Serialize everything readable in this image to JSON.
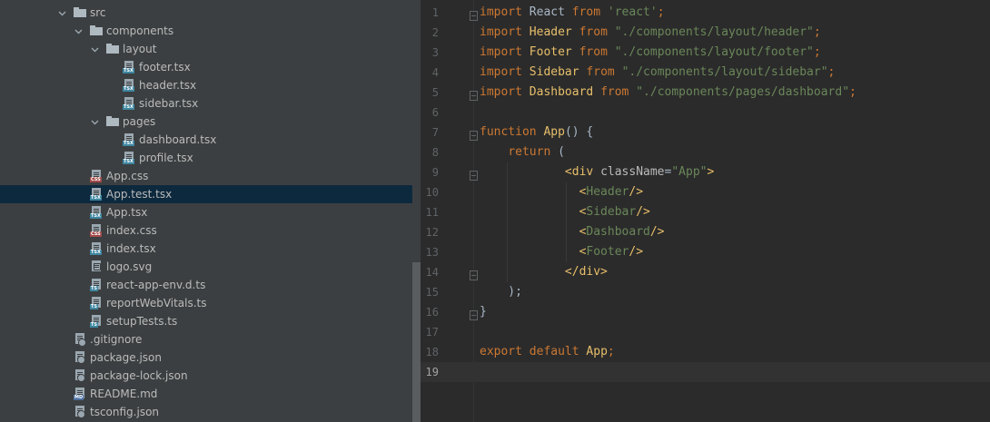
{
  "project_tree": {
    "items": [
      {
        "label": "src",
        "kind": "folder",
        "expanded": true,
        "depth": 0
      },
      {
        "label": "components",
        "kind": "folder",
        "expanded": true,
        "depth": 1
      },
      {
        "label": "layout",
        "kind": "folder",
        "expanded": true,
        "depth": 2
      },
      {
        "label": "footer.tsx",
        "kind": "tsx",
        "depth": 3
      },
      {
        "label": "header.tsx",
        "kind": "tsx",
        "depth": 3
      },
      {
        "label": "sidebar.tsx",
        "kind": "tsx",
        "depth": 3
      },
      {
        "label": "pages",
        "kind": "folder",
        "expanded": true,
        "depth": 2
      },
      {
        "label": "dashboard.tsx",
        "kind": "tsx",
        "depth": 3
      },
      {
        "label": "profile.tsx",
        "kind": "tsx",
        "depth": 3
      },
      {
        "label": "App.css",
        "kind": "css",
        "depth": 1
      },
      {
        "label": "App.test.tsx",
        "kind": "tsx",
        "depth": 1,
        "selected": true
      },
      {
        "label": "App.tsx",
        "kind": "tsx",
        "depth": 1
      },
      {
        "label": "index.css",
        "kind": "css",
        "depth": 1
      },
      {
        "label": "index.tsx",
        "kind": "tsx",
        "depth": 1
      },
      {
        "label": "logo.svg",
        "kind": "svg",
        "depth": 1
      },
      {
        "label": "react-app-env.d.ts",
        "kind": "ts",
        "depth": 1
      },
      {
        "label": "reportWebVitals.ts",
        "kind": "ts",
        "depth": 1
      },
      {
        "label": "setupTests.ts",
        "kind": "ts",
        "depth": 1
      },
      {
        "label": ".gitignore",
        "kind": "gitignore",
        "depth": 0
      },
      {
        "label": "package.json",
        "kind": "json",
        "depth": 0
      },
      {
        "label": "package-lock.json",
        "kind": "json",
        "depth": 0
      },
      {
        "label": "README.md",
        "kind": "md",
        "depth": 0
      },
      {
        "label": "tsconfig.json",
        "kind": "json",
        "depth": 0
      }
    ]
  },
  "icons": {
    "folder": "folder-icon",
    "tsx": "tsx-file-icon",
    "ts": "ts-file-icon",
    "css": "css-file-icon",
    "svg": "svg-file-icon",
    "gitignore": "gitignore-file-icon",
    "json": "json-file-icon",
    "md": "markdown-file-icon",
    "chevron": "chevron-down-icon"
  },
  "file_tag_text": {
    "tsx": "TSX",
    "ts": "TS",
    "css": "CSS",
    "md": "MD"
  },
  "editor": {
    "current_line": 19,
    "lines": [
      {
        "n": "1",
        "tokens": [
          [
            "kw",
            "import"
          ],
          [
            "plain",
            " React "
          ],
          [
            "kw",
            "from"
          ],
          [
            "plain",
            " "
          ],
          [
            "str",
            "'react'"
          ],
          [
            "kw",
            ";"
          ]
        ],
        "fold": true
      },
      {
        "n": "2",
        "tokens": [
          [
            "kw",
            "import"
          ],
          [
            "plain",
            " "
          ],
          [
            "ident",
            "Header"
          ],
          [
            "plain",
            " "
          ],
          [
            "kw",
            "from"
          ],
          [
            "plain",
            " "
          ],
          [
            "str",
            "\"./components/layout/header\""
          ],
          [
            "kw",
            ";"
          ]
        ]
      },
      {
        "n": "3",
        "tokens": [
          [
            "kw",
            "import"
          ],
          [
            "plain",
            " "
          ],
          [
            "ident",
            "Footer"
          ],
          [
            "plain",
            " "
          ],
          [
            "kw",
            "from"
          ],
          [
            "plain",
            " "
          ],
          [
            "str",
            "\"./components/layout/footer\""
          ],
          [
            "kw",
            ";"
          ]
        ]
      },
      {
        "n": "4",
        "tokens": [
          [
            "kw",
            "import"
          ],
          [
            "plain",
            " "
          ],
          [
            "ident",
            "Sidebar"
          ],
          [
            "plain",
            " "
          ],
          [
            "kw",
            "from"
          ],
          [
            "plain",
            " "
          ],
          [
            "str",
            "\"./components/layout/sidebar\""
          ],
          [
            "kw",
            ";"
          ]
        ]
      },
      {
        "n": "5",
        "tokens": [
          [
            "kw",
            "import"
          ],
          [
            "plain",
            " "
          ],
          [
            "ident",
            "Dashboard"
          ],
          [
            "plain",
            " "
          ],
          [
            "kw",
            "from"
          ],
          [
            "plain",
            " "
          ],
          [
            "str",
            "\"./components/pages/dashboard\""
          ],
          [
            "kw",
            ";"
          ]
        ],
        "fold": true
      },
      {
        "n": "6",
        "tokens": []
      },
      {
        "n": "7",
        "tokens": [
          [
            "kw",
            "function"
          ],
          [
            "plain",
            " "
          ],
          [
            "ident",
            "App"
          ],
          [
            "plain",
            "() {"
          ]
        ],
        "fold": true
      },
      {
        "n": "8",
        "tokens": [
          [
            "plain",
            "    "
          ],
          [
            "kw",
            "return"
          ],
          [
            "plain",
            " ("
          ]
        ]
      },
      {
        "n": "9",
        "tokens": [
          [
            "plain",
            "            "
          ],
          [
            "tag-name",
            "<div"
          ],
          [
            "plain",
            " "
          ],
          [
            "attr",
            "className"
          ],
          [
            "plain",
            "="
          ],
          [
            "str",
            "\"App\""
          ],
          [
            "tag-name",
            ">"
          ]
        ],
        "fold": true
      },
      {
        "n": "10",
        "tokens": [
          [
            "plain",
            "              "
          ],
          [
            "tag-name",
            "<"
          ],
          [
            "str",
            "Header"
          ],
          [
            "tag-name",
            "/>"
          ]
        ]
      },
      {
        "n": "11",
        "tokens": [
          [
            "plain",
            "              "
          ],
          [
            "tag-name",
            "<"
          ],
          [
            "str",
            "Sidebar"
          ],
          [
            "tag-name",
            "/>"
          ]
        ]
      },
      {
        "n": "12",
        "tokens": [
          [
            "plain",
            "              "
          ],
          [
            "tag-name",
            "<"
          ],
          [
            "str",
            "Dashboard"
          ],
          [
            "tag-name",
            "/>"
          ]
        ]
      },
      {
        "n": "13",
        "tokens": [
          [
            "plain",
            "              "
          ],
          [
            "tag-name",
            "<"
          ],
          [
            "str",
            "Footer"
          ],
          [
            "tag-name",
            "/>"
          ]
        ]
      },
      {
        "n": "14",
        "tokens": [
          [
            "plain",
            "            "
          ],
          [
            "tag-name",
            "</div>"
          ]
        ],
        "fold": true
      },
      {
        "n": "15",
        "tokens": [
          [
            "plain",
            "    );"
          ]
        ]
      },
      {
        "n": "16",
        "tokens": [
          [
            "plain",
            "}"
          ]
        ],
        "fold": true
      },
      {
        "n": "17",
        "tokens": []
      },
      {
        "n": "18",
        "tokens": [
          [
            "kw",
            "export"
          ],
          [
            "plain",
            " "
          ],
          [
            "kw",
            "default"
          ],
          [
            "plain",
            " "
          ],
          [
            "ident",
            "App"
          ],
          [
            "kw",
            ";"
          ]
        ]
      },
      {
        "n": "19",
        "tokens": []
      }
    ]
  },
  "colors": {
    "tree_bg": "#3c3f41",
    "selection": "#0d293e",
    "editor_bg": "#2b2b2b",
    "keyword": "#cc7832",
    "string": "#6a8759",
    "identifier": "#e8bf6a"
  }
}
